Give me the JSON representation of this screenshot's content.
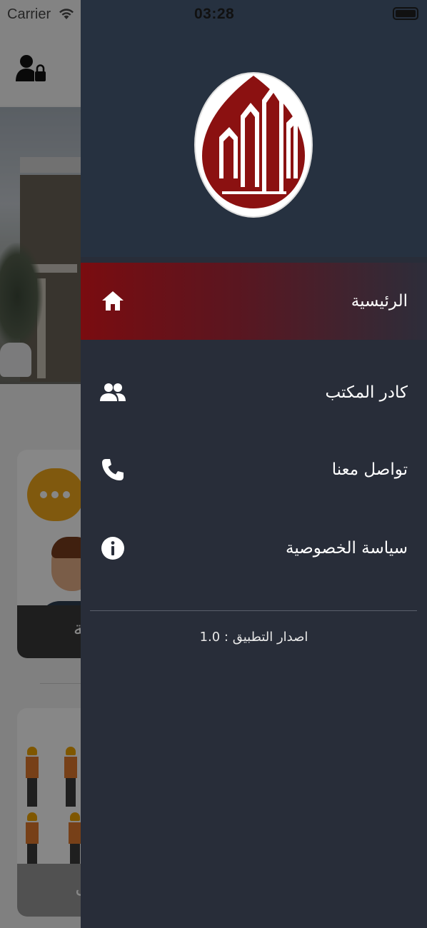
{
  "status_bar": {
    "carrier": "Carrier",
    "time": "03:28"
  },
  "background": {
    "card_bottom_text_1": "ية",
    "card_bottom_text_2": "ل"
  },
  "drawer": {
    "menu": [
      {
        "label": "الرئيسية",
        "icon": "home-icon",
        "active": true
      },
      {
        "label": "كادر المكتب",
        "icon": "people-icon",
        "active": false
      },
      {
        "label": "تواصل معنا",
        "icon": "phone-icon",
        "active": false
      },
      {
        "label": "سياسة الخصوصية",
        "icon": "info-icon",
        "active": false
      }
    ],
    "version_text": "اصدار التطبيق : 1.0"
  },
  "colors": {
    "drawer_bg": "#282d39",
    "drawer_header_bg": "#263140",
    "active_item": "#7a0c10",
    "logo_red": "#8b1111"
  }
}
